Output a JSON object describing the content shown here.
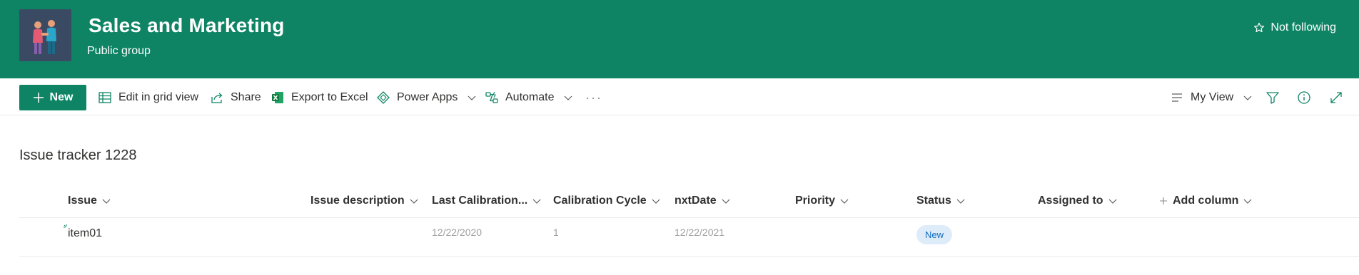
{
  "site": {
    "title": "Sales and Marketing",
    "subtitle": "Public group",
    "follow_label": "Not following"
  },
  "toolbar": {
    "new_label": "New",
    "edit_grid_label": "Edit in grid view",
    "share_label": "Share",
    "export_label": "Export to Excel",
    "power_apps_label": "Power Apps",
    "automate_label": "Automate",
    "more_label": "···",
    "view_label": "My View"
  },
  "list": {
    "title": "Issue tracker 1228",
    "columns": [
      "Issue",
      "Issue description",
      "Last Calibration...",
      "Calibration Cycle",
      "nxtDate",
      "Priority",
      "Status",
      "Assigned to",
      "Add column"
    ],
    "rows": [
      {
        "issue": "item01",
        "issue_description": "",
        "last_calibration": "12/22/2020",
        "calibration_cycle": "1",
        "nxt_date": "12/22/2021",
        "priority": "",
        "status": "New",
        "assigned_to": ""
      }
    ]
  },
  "colors": {
    "header_bg": "#0e8465",
    "accent": "#0e8465",
    "status_badge_bg": "#deecf9",
    "status_badge_text": "#0f6cbd"
  },
  "icons": [
    "group-logo-icon",
    "star-icon",
    "plus-icon",
    "grid-icon",
    "share-icon",
    "excel-icon",
    "power-apps-icon",
    "automate-icon",
    "view-lines-icon",
    "filter-icon",
    "info-icon",
    "expand-icon",
    "chevron-down-icon",
    "new-item-sparkle-icon"
  ]
}
